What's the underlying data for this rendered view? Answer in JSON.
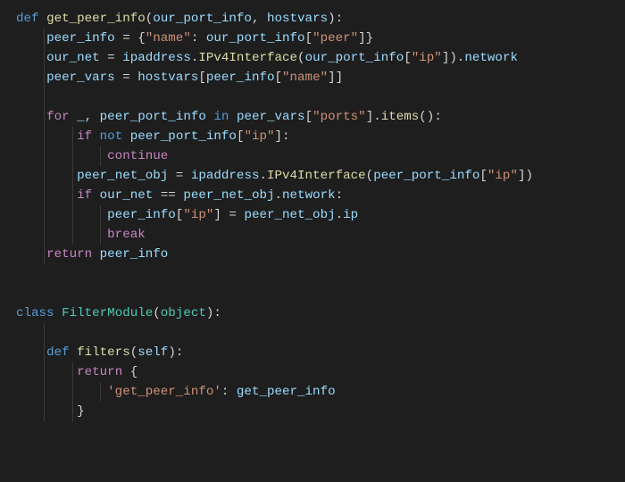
{
  "code": {
    "lines": [
      [
        {
          "cls": "tok-kw",
          "t": "def "
        },
        {
          "cls": "tok-func",
          "t": "get_peer_info"
        },
        {
          "cls": "tok-punc",
          "t": "("
        },
        {
          "cls": "tok-var",
          "t": "our_port_info"
        },
        {
          "cls": "tok-punc",
          "t": ", "
        },
        {
          "cls": "tok-var",
          "t": "hostvars"
        },
        {
          "cls": "tok-punc",
          "t": "):"
        }
      ],
      [
        {
          "cls": "",
          "t": "    "
        },
        {
          "cls": "tok-var",
          "t": "peer_info"
        },
        {
          "cls": "tok-punc",
          "t": " = {"
        },
        {
          "cls": "tok-str",
          "t": "\"name\""
        },
        {
          "cls": "tok-punc",
          "t": ": "
        },
        {
          "cls": "tok-var",
          "t": "our_port_info"
        },
        {
          "cls": "tok-punc",
          "t": "["
        },
        {
          "cls": "tok-str",
          "t": "\"peer\""
        },
        {
          "cls": "tok-punc",
          "t": "]}"
        }
      ],
      [
        {
          "cls": "",
          "t": "    "
        },
        {
          "cls": "tok-var",
          "t": "our_net"
        },
        {
          "cls": "tok-punc",
          "t": " = "
        },
        {
          "cls": "tok-var",
          "t": "ipaddress"
        },
        {
          "cls": "tok-punc",
          "t": "."
        },
        {
          "cls": "tok-func",
          "t": "IPv4Interface"
        },
        {
          "cls": "tok-punc",
          "t": "("
        },
        {
          "cls": "tok-var",
          "t": "our_port_info"
        },
        {
          "cls": "tok-punc",
          "t": "["
        },
        {
          "cls": "tok-str",
          "t": "\"ip\""
        },
        {
          "cls": "tok-punc",
          "t": "])."
        },
        {
          "cls": "tok-var",
          "t": "network"
        }
      ],
      [
        {
          "cls": "",
          "t": "    "
        },
        {
          "cls": "tok-var",
          "t": "peer_vars"
        },
        {
          "cls": "tok-punc",
          "t": " = "
        },
        {
          "cls": "tok-var",
          "t": "hostvars"
        },
        {
          "cls": "tok-punc",
          "t": "["
        },
        {
          "cls": "tok-var",
          "t": "peer_info"
        },
        {
          "cls": "tok-punc",
          "t": "["
        },
        {
          "cls": "tok-str",
          "t": "\"name\""
        },
        {
          "cls": "tok-punc",
          "t": "]]"
        }
      ],
      [
        {
          "cls": "",
          "t": ""
        }
      ],
      [
        {
          "cls": "",
          "t": "    "
        },
        {
          "cls": "tok-ctrl",
          "t": "for"
        },
        {
          "cls": "tok-punc",
          "t": " "
        },
        {
          "cls": "tok-var",
          "t": "_"
        },
        {
          "cls": "tok-punc",
          "t": ", "
        },
        {
          "cls": "tok-var",
          "t": "peer_port_info"
        },
        {
          "cls": "tok-punc",
          "t": " "
        },
        {
          "cls": "tok-kw",
          "t": "in"
        },
        {
          "cls": "tok-punc",
          "t": " "
        },
        {
          "cls": "tok-var",
          "t": "peer_vars"
        },
        {
          "cls": "tok-punc",
          "t": "["
        },
        {
          "cls": "tok-str",
          "t": "\"ports\""
        },
        {
          "cls": "tok-punc",
          "t": "]."
        },
        {
          "cls": "tok-func",
          "t": "items"
        },
        {
          "cls": "tok-punc",
          "t": "():"
        }
      ],
      [
        {
          "cls": "",
          "t": "        "
        },
        {
          "cls": "tok-ctrl",
          "t": "if"
        },
        {
          "cls": "tok-punc",
          "t": " "
        },
        {
          "cls": "tok-kw",
          "t": "not"
        },
        {
          "cls": "tok-punc",
          "t": " "
        },
        {
          "cls": "tok-var",
          "t": "peer_port_info"
        },
        {
          "cls": "tok-punc",
          "t": "["
        },
        {
          "cls": "tok-str",
          "t": "\"ip\""
        },
        {
          "cls": "tok-punc",
          "t": "]:"
        }
      ],
      [
        {
          "cls": "",
          "t": "            "
        },
        {
          "cls": "tok-ctrl",
          "t": "continue"
        }
      ],
      [
        {
          "cls": "",
          "t": "        "
        },
        {
          "cls": "tok-var",
          "t": "peer_net_obj"
        },
        {
          "cls": "tok-punc",
          "t": " = "
        },
        {
          "cls": "tok-var",
          "t": "ipaddress"
        },
        {
          "cls": "tok-punc",
          "t": "."
        },
        {
          "cls": "tok-func",
          "t": "IPv4Interface"
        },
        {
          "cls": "tok-punc",
          "t": "("
        },
        {
          "cls": "tok-var",
          "t": "peer_port_info"
        },
        {
          "cls": "tok-punc",
          "t": "["
        },
        {
          "cls": "tok-str",
          "t": "\"ip\""
        },
        {
          "cls": "tok-punc",
          "t": "])"
        }
      ],
      [
        {
          "cls": "",
          "t": "        "
        },
        {
          "cls": "tok-ctrl",
          "t": "if"
        },
        {
          "cls": "tok-punc",
          "t": " "
        },
        {
          "cls": "tok-var",
          "t": "our_net"
        },
        {
          "cls": "tok-punc",
          "t": " == "
        },
        {
          "cls": "tok-var",
          "t": "peer_net_obj"
        },
        {
          "cls": "tok-punc",
          "t": "."
        },
        {
          "cls": "tok-var",
          "t": "network"
        },
        {
          "cls": "tok-punc",
          "t": ":"
        }
      ],
      [
        {
          "cls": "",
          "t": "            "
        },
        {
          "cls": "tok-var",
          "t": "peer_info"
        },
        {
          "cls": "tok-punc",
          "t": "["
        },
        {
          "cls": "tok-str",
          "t": "\"ip\""
        },
        {
          "cls": "tok-punc",
          "t": "] = "
        },
        {
          "cls": "tok-var",
          "t": "peer_net_obj"
        },
        {
          "cls": "tok-punc",
          "t": "."
        },
        {
          "cls": "tok-var",
          "t": "ip"
        }
      ],
      [
        {
          "cls": "",
          "t": "            "
        },
        {
          "cls": "tok-ctrl",
          "t": "break"
        }
      ],
      [
        {
          "cls": "",
          "t": "    "
        },
        {
          "cls": "tok-ctrl",
          "t": "return"
        },
        {
          "cls": "tok-punc",
          "t": " "
        },
        {
          "cls": "tok-var",
          "t": "peer_info"
        }
      ],
      [
        {
          "cls": "",
          "t": ""
        }
      ],
      [
        {
          "cls": "",
          "t": ""
        }
      ],
      [
        {
          "cls": "tok-kw",
          "t": "class "
        },
        {
          "cls": "tok-type",
          "t": "FilterModule"
        },
        {
          "cls": "tok-punc",
          "t": "("
        },
        {
          "cls": "tok-type",
          "t": "object"
        },
        {
          "cls": "tok-punc",
          "t": "):"
        }
      ],
      [
        {
          "cls": "",
          "t": ""
        }
      ],
      [
        {
          "cls": "",
          "t": "    "
        },
        {
          "cls": "tok-kw",
          "t": "def "
        },
        {
          "cls": "tok-func",
          "t": "filters"
        },
        {
          "cls": "tok-punc",
          "t": "("
        },
        {
          "cls": "tok-var",
          "t": "self"
        },
        {
          "cls": "tok-punc",
          "t": "):"
        }
      ],
      [
        {
          "cls": "",
          "t": "        "
        },
        {
          "cls": "tok-ctrl",
          "t": "return"
        },
        {
          "cls": "tok-punc",
          "t": " {"
        }
      ],
      [
        {
          "cls": "",
          "t": "            "
        },
        {
          "cls": "tok-str",
          "t": "'get_peer_info'"
        },
        {
          "cls": "tok-punc",
          "t": ": "
        },
        {
          "cls": "tok-var",
          "t": "get_peer_info"
        }
      ],
      [
        {
          "cls": "",
          "t": "        }"
        }
      ]
    ],
    "guides": [
      {
        "col": 4,
        "startLine": 1,
        "endLine": 12
      },
      {
        "col": 8,
        "startLine": 6,
        "endLine": 11
      },
      {
        "col": 12,
        "startLine": 7,
        "endLine": 7
      },
      {
        "col": 12,
        "startLine": 10,
        "endLine": 11
      },
      {
        "col": 4,
        "startLine": 16,
        "endLine": 20
      },
      {
        "col": 8,
        "startLine": 18,
        "endLine": 20
      },
      {
        "col": 12,
        "startLine": 19,
        "endLine": 19
      }
    ]
  }
}
